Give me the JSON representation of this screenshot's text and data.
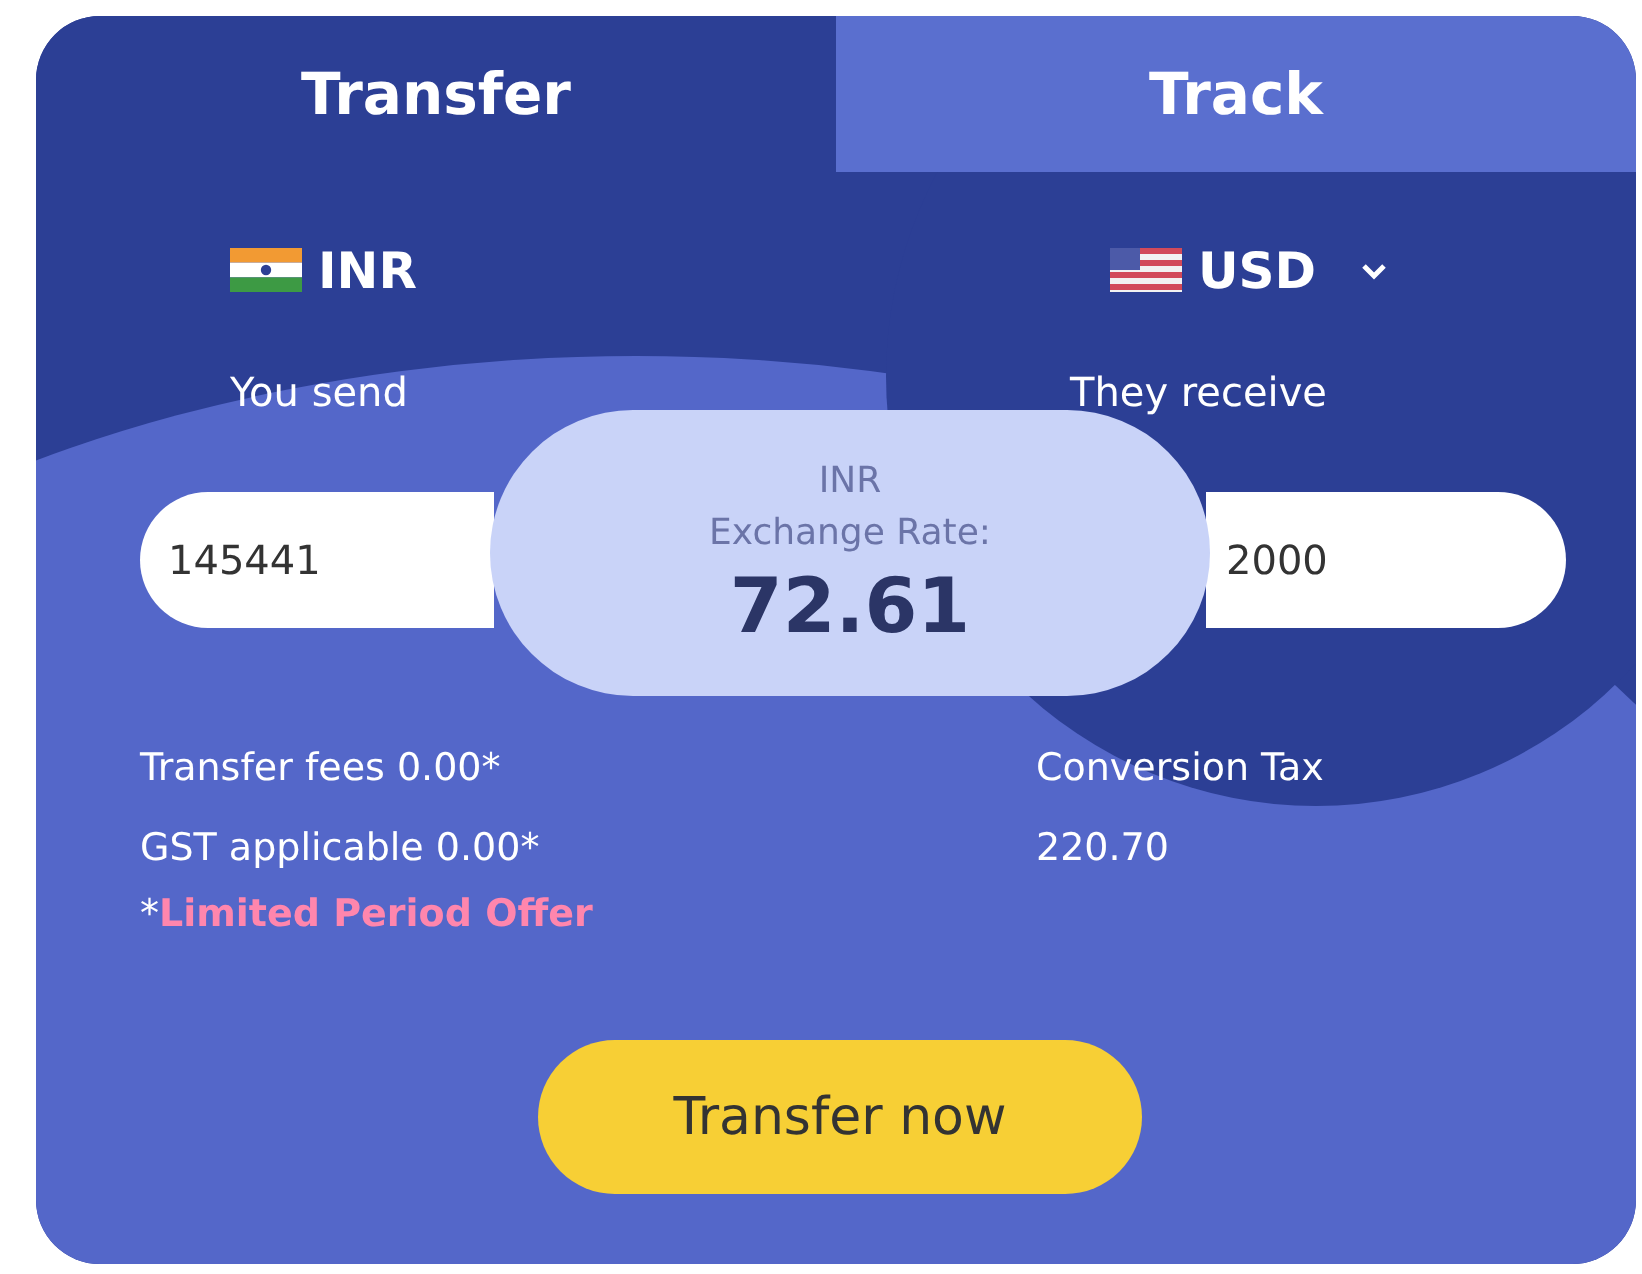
{
  "tabs": [
    {
      "label": "Transfer",
      "selected": true
    },
    {
      "label": "Track",
      "selected": false
    }
  ],
  "send": {
    "currency": "INR",
    "label": "You send",
    "amount": "145441"
  },
  "receive": {
    "currency": "USD",
    "dropdown": true,
    "label": "They receive",
    "amount": "2000"
  },
  "rate": {
    "currency": "INR",
    "label": "Exchange Rate:",
    "value": "72.61"
  },
  "fees": [
    "Transfer fees 0.00*",
    "GST applicable 0.00*"
  ],
  "tax": {
    "label": "Conversion Tax",
    "value": "220.70"
  },
  "offer": {
    "mark": "*",
    "text": "Limited Period Offer"
  },
  "button": "Transfer now"
}
